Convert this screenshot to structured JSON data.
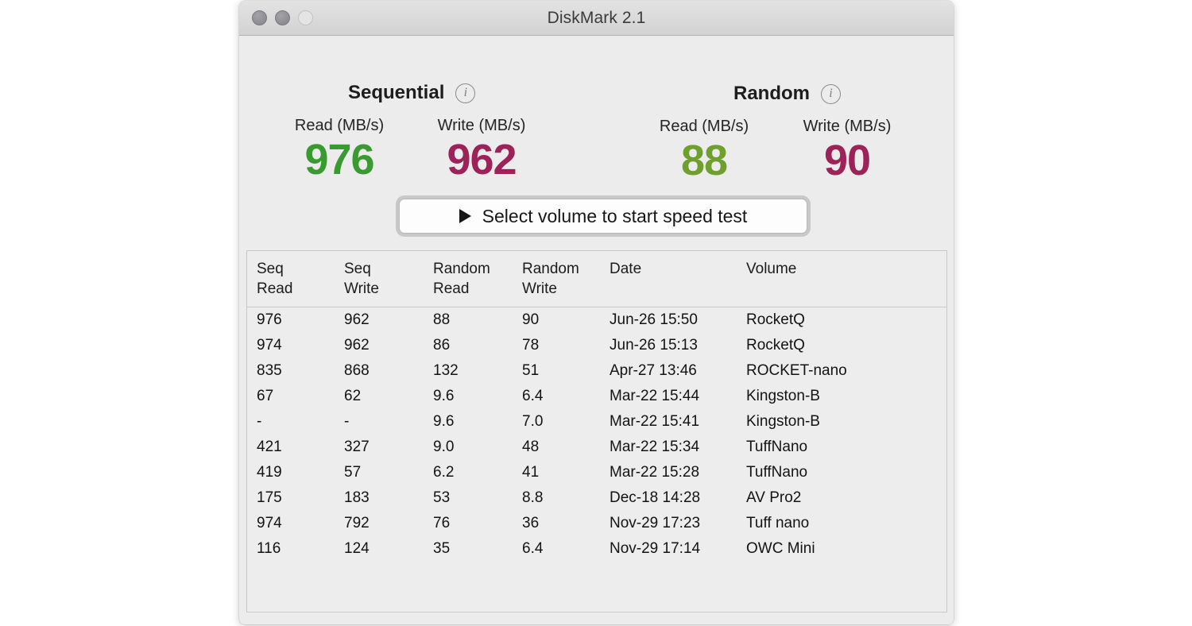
{
  "window": {
    "title": "DiskMark 2.1",
    "traffic_lights": [
      {
        "name": "close-button",
        "state": "inactive"
      },
      {
        "name": "minimize-button",
        "state": "inactive"
      },
      {
        "name": "zoom-button",
        "state": "inactive"
      }
    ]
  },
  "stats": {
    "sequential": {
      "title": "Sequential",
      "info_icon": "info-icon",
      "info_glyph": "i",
      "read": {
        "label": "Read (MB/s)",
        "value": "976",
        "color": "#3a9a32"
      },
      "write": {
        "label": "Write (MB/s)",
        "value": "962",
        "color": "#9c2257"
      }
    },
    "random": {
      "title": "Random",
      "info_icon": "info-icon",
      "info_glyph": "i",
      "read": {
        "label": "Read (MB/s)",
        "value": "88",
        "color": "#6fa02e"
      },
      "write": {
        "label": "Write (MB/s)",
        "value": "90",
        "color": "#9c2257"
      }
    }
  },
  "action": {
    "icon": "play-triangle-icon",
    "label": "Select volume to start speed test"
  },
  "results": {
    "columns": [
      {
        "line1": "Seq",
        "line2": "Read"
      },
      {
        "line1": "Seq",
        "line2": "Write"
      },
      {
        "line1": "Random",
        "line2": "Read"
      },
      {
        "line1": "Random",
        "line2": "Write"
      },
      {
        "line1": "Date",
        "line2": ""
      },
      {
        "line1": "Volume",
        "line2": ""
      }
    ],
    "rows": [
      {
        "seq_read": "976",
        "seq_write": "962",
        "rand_read": "88",
        "rand_write": "90",
        "date": "Jun-26 15:50",
        "volume": "RocketQ"
      },
      {
        "seq_read": "974",
        "seq_write": "962",
        "rand_read": "86",
        "rand_write": "78",
        "date": "Jun-26 15:13",
        "volume": "RocketQ"
      },
      {
        "seq_read": "835",
        "seq_write": "868",
        "rand_read": "132",
        "rand_write": "51",
        "date": "Apr-27 13:46",
        "volume": "ROCKET-nano"
      },
      {
        "seq_read": "67",
        "seq_write": "62",
        "rand_read": "9.6",
        "rand_write": "6.4",
        "date": "Mar-22 15:44",
        "volume": "Kingston-B"
      },
      {
        "seq_read": "-",
        "seq_write": "-",
        "rand_read": "9.6",
        "rand_write": "7.0",
        "date": "Mar-22 15:41",
        "volume": "Kingston-B"
      },
      {
        "seq_read": "421",
        "seq_write": "327",
        "rand_read": "9.0",
        "rand_write": "48",
        "date": "Mar-22 15:34",
        "volume": "TuffNano"
      },
      {
        "seq_read": "419",
        "seq_write": "57",
        "rand_read": "6.2",
        "rand_write": "41",
        "date": "Mar-22 15:28",
        "volume": "TuffNano"
      },
      {
        "seq_read": "175",
        "seq_write": "183",
        "rand_read": "53",
        "rand_write": "8.8",
        "date": "Dec-18 14:28",
        "volume": "AV Pro2"
      },
      {
        "seq_read": "974",
        "seq_write": "792",
        "rand_read": "76",
        "rand_write": "36",
        "date": "Nov-29 17:23",
        "volume": "Tuff nano"
      },
      {
        "seq_read": "116",
        "seq_write": "124",
        "rand_read": "35",
        "rand_write": "6.4",
        "date": "Nov-29 17:14",
        "volume": "OWC Mini"
      }
    ]
  }
}
